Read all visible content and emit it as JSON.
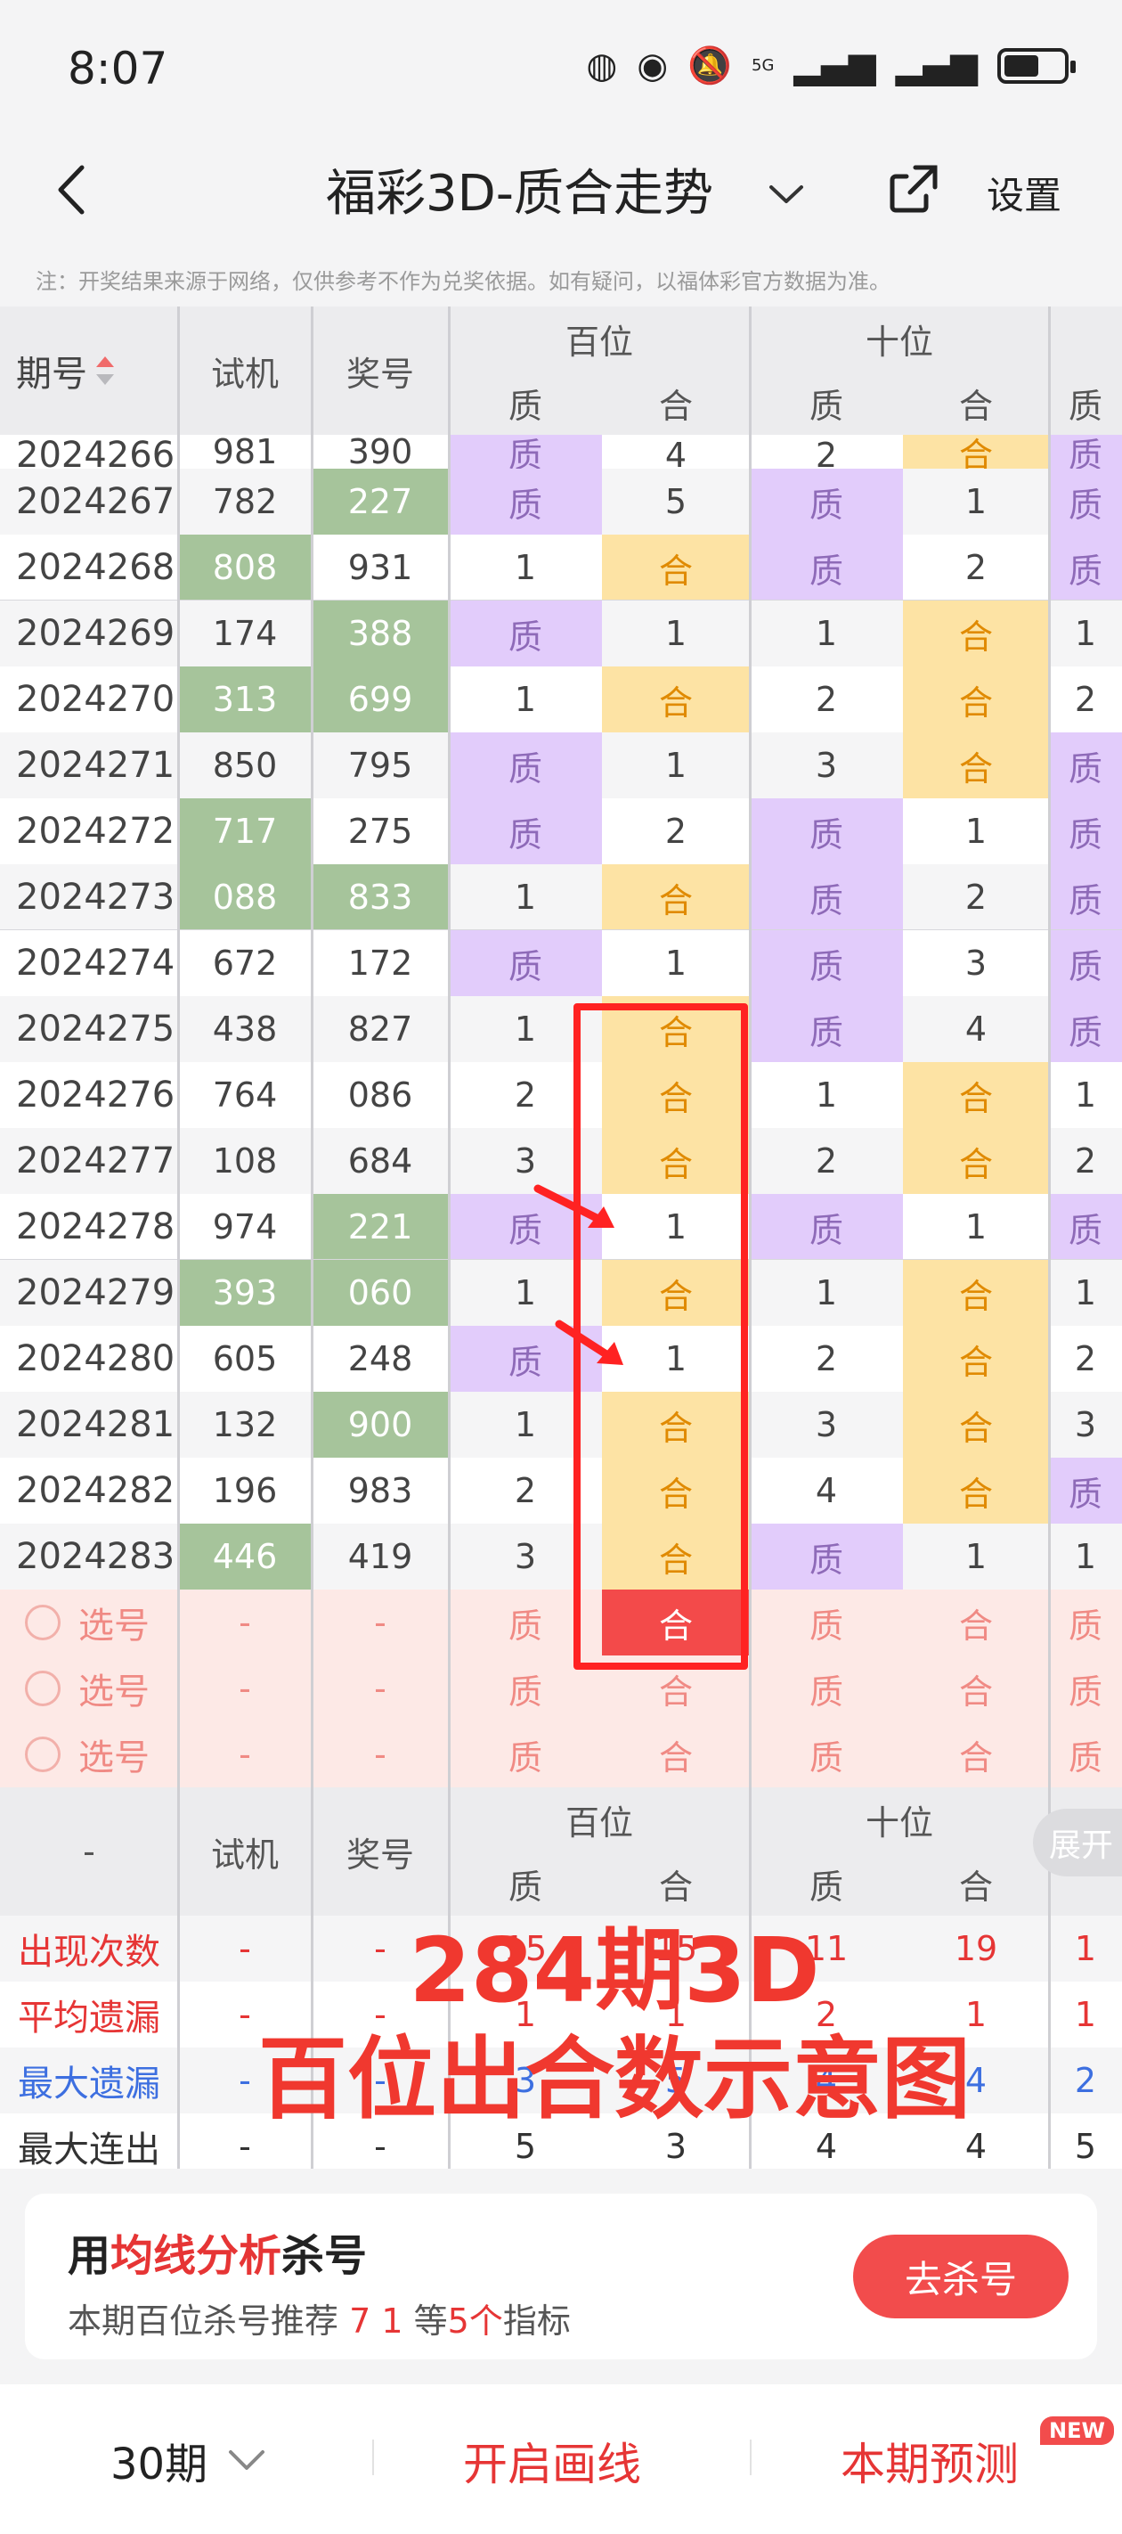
{
  "status_bar": {
    "time": "8:07",
    "network_label": "5G"
  },
  "nav": {
    "title": "福彩3D-质合走势",
    "settings_label": "设置"
  },
  "note": "注：开奖结果来源于网络，仅供参考不作为兑奖依据。如有疑问，以福体彩官方数据为准。",
  "table": {
    "headers": {
      "period": "期号",
      "trial": "试机",
      "prize": "奖号",
      "hundreds": "百位",
      "tens": "十位",
      "prime": "质",
      "composite": "合",
      "cut_prime": "质"
    },
    "rows": [
      {
        "period": "2024266",
        "trial": "981",
        "prize": "390",
        "cells": [
          "质",
          "4",
          "2",
          "合",
          "质"
        ]
      },
      {
        "period": "2024267",
        "trial": "782",
        "prize": "227",
        "cells": [
          "质",
          "5",
          "质",
          "1",
          "质"
        ]
      },
      {
        "period": "2024268",
        "trial": "808",
        "prize": "931",
        "cells": [
          "1",
          "合",
          "质",
          "2",
          "质"
        ]
      },
      {
        "period": "2024269",
        "trial": "174",
        "prize": "388",
        "cells": [
          "质",
          "1",
          "1",
          "合",
          "1"
        ]
      },
      {
        "period": "2024270",
        "trial": "313",
        "prize": "699",
        "cells": [
          "1",
          "合",
          "2",
          "合",
          "2"
        ]
      },
      {
        "period": "2024271",
        "trial": "850",
        "prize": "795",
        "cells": [
          "质",
          "1",
          "3",
          "合",
          "质"
        ]
      },
      {
        "period": "2024272",
        "trial": "717",
        "prize": "275",
        "cells": [
          "质",
          "2",
          "质",
          "1",
          "质"
        ]
      },
      {
        "period": "2024273",
        "trial": "088",
        "prize": "833",
        "cells": [
          "1",
          "合",
          "质",
          "2",
          "质"
        ]
      },
      {
        "period": "2024274",
        "trial": "672",
        "prize": "172",
        "cells": [
          "质",
          "1",
          "质",
          "3",
          "质"
        ]
      },
      {
        "period": "2024275",
        "trial": "438",
        "prize": "827",
        "cells": [
          "1",
          "合",
          "质",
          "4",
          "质"
        ]
      },
      {
        "period": "2024276",
        "trial": "764",
        "prize": "086",
        "cells": [
          "2",
          "合",
          "1",
          "合",
          "1"
        ]
      },
      {
        "period": "2024277",
        "trial": "108",
        "prize": "684",
        "cells": [
          "3",
          "合",
          "2",
          "合",
          "2"
        ]
      },
      {
        "period": "2024278",
        "trial": "974",
        "prize": "221",
        "cells": [
          "质",
          "1",
          "质",
          "1",
          "质"
        ]
      },
      {
        "period": "2024279",
        "trial": "393",
        "prize": "060",
        "cells": [
          "1",
          "合",
          "1",
          "合",
          "1"
        ]
      },
      {
        "period": "2024280",
        "trial": "605",
        "prize": "248",
        "cells": [
          "质",
          "1",
          "2",
          "合",
          "2"
        ]
      },
      {
        "period": "2024281",
        "trial": "132",
        "prize": "900",
        "cells": [
          "1",
          "合",
          "3",
          "合",
          "3"
        ]
      },
      {
        "period": "2024282",
        "trial": "196",
        "prize": "983",
        "cells": [
          "2",
          "合",
          "4",
          "合",
          "质"
        ]
      },
      {
        "period": "2024283",
        "trial": "446",
        "prize": "419",
        "cells": [
          "3",
          "合",
          "质",
          "1",
          "1"
        ]
      }
    ],
    "pick_rows": [
      {
        "label": "选号",
        "trial": "-",
        "prize": "-",
        "cells": [
          "质",
          "合",
          "质",
          "合",
          "质"
        ]
      },
      {
        "label": "选号",
        "trial": "-",
        "prize": "-",
        "cells": [
          "质",
          "合",
          "质",
          "合",
          "质"
        ]
      },
      {
        "label": "选号",
        "trial": "-",
        "prize": "-",
        "cells": [
          "质",
          "合",
          "质",
          "合",
          "质"
        ]
      }
    ],
    "footer_header": {
      "dash": "-",
      "trial": "试机",
      "prize": "奖号",
      "hundreds": "百位",
      "tens": "十位",
      "prime": "质",
      "composite": "合"
    },
    "stats": [
      {
        "label": "出现次数",
        "trial": "-",
        "prize": "-",
        "cells": [
          "15",
          "15",
          "11",
          "19",
          "1"
        ]
      },
      {
        "label": "平均遗漏",
        "trial": "-",
        "prize": "-",
        "cells": [
          "1",
          "1",
          "2",
          "1",
          "1"
        ]
      },
      {
        "label": "最大遗漏",
        "trial": "-",
        "prize": "-",
        "cells": [
          "3",
          "5",
          "4",
          "4",
          "2"
        ]
      },
      {
        "label": "最大连出",
        "trial": "-",
        "prize": "-",
        "cells": [
          "5",
          "3",
          "4",
          "4",
          "5"
        ]
      }
    ],
    "expand_label": "展开"
  },
  "overlay": {
    "line1": "284期3D",
    "line2": "百位出合数示意图"
  },
  "promo": {
    "title_pre": "用",
    "title_red": "均线分析",
    "title_post": "杀号",
    "sub_pre": "本期百位杀号推荐",
    "sub_nums": "7 1",
    "sub_mid": "等",
    "sub_count": "5个",
    "sub_post": "指标",
    "button": "去杀号"
  },
  "bottom_bar": {
    "periods": "30期",
    "draw_line": "开启画线",
    "predict": "本期预测",
    "new_badge": "NEW"
  }
}
